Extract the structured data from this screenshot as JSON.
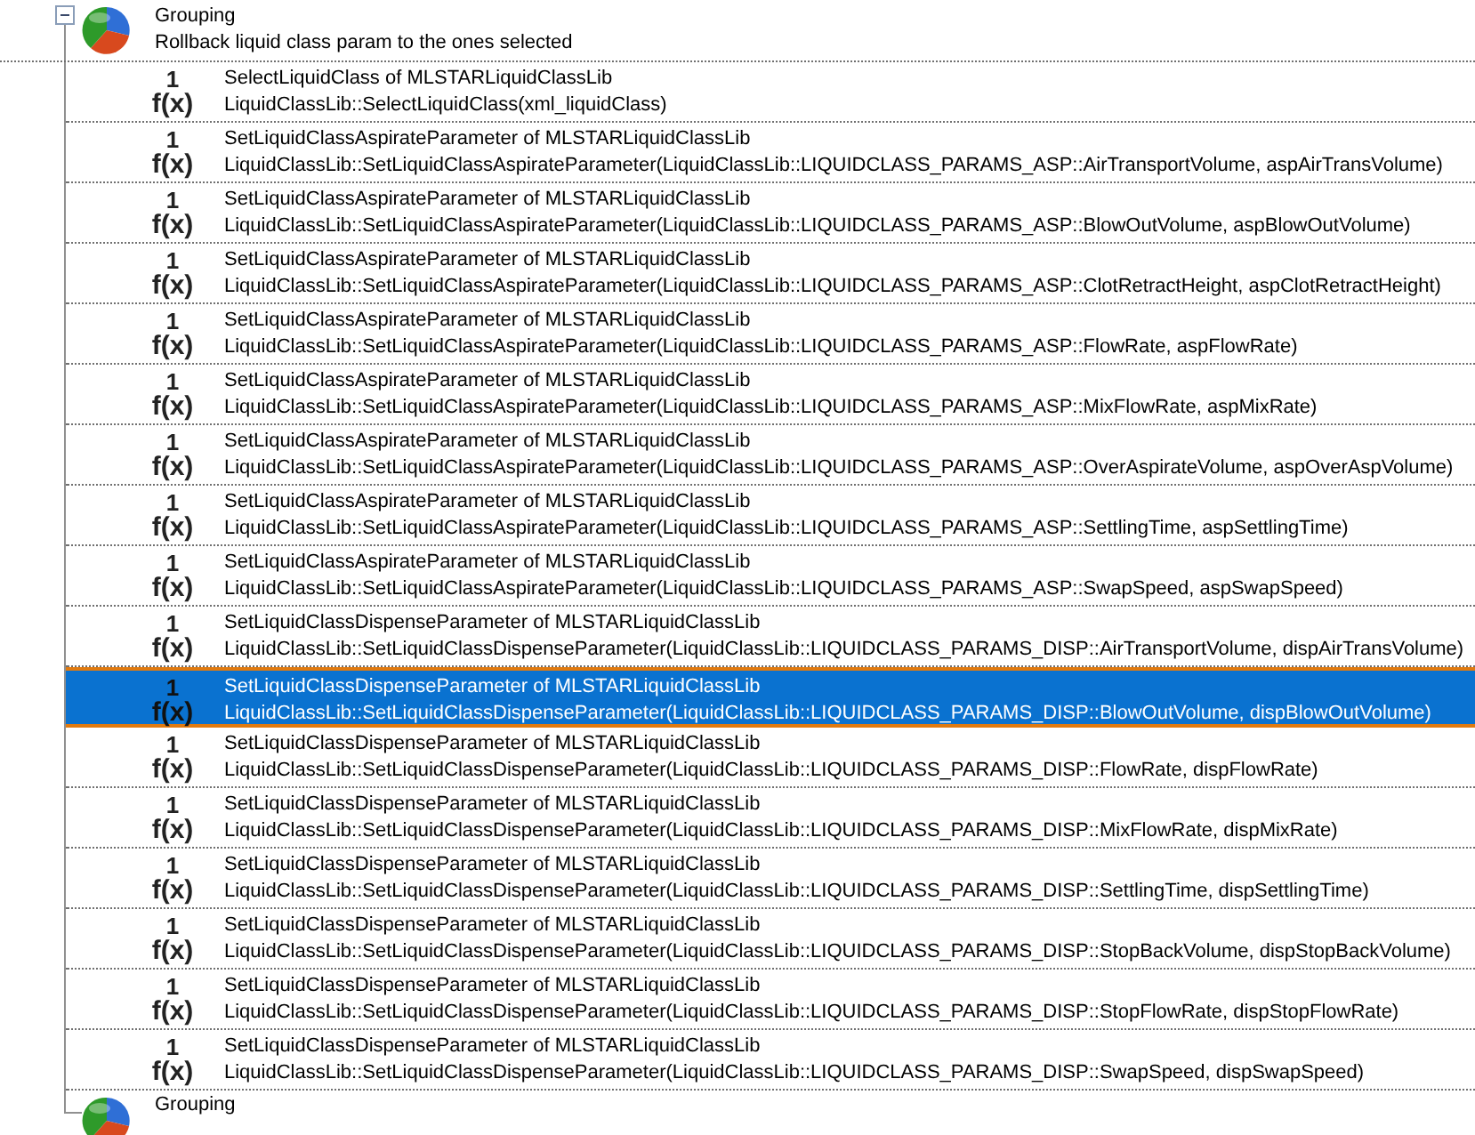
{
  "group": {
    "title": "Grouping",
    "comment": "Rollback liquid class param to the ones selected",
    "expanded": true
  },
  "steps": [
    {
      "number": "1",
      "icon_text": "f(x)",
      "title": "SelectLiquidClass of MLSTARLiquidClassLib",
      "call": "LiquidClassLib::SelectLiquidClass(xml_liquidClass)",
      "selected": false
    },
    {
      "number": "1",
      "icon_text": "f(x)",
      "title": "SetLiquidClassAspirateParameter of MLSTARLiquidClassLib",
      "call": "LiquidClassLib::SetLiquidClassAspirateParameter(LiquidClassLib::LIQUIDCLASS_PARAMS_ASP::AirTransportVolume, aspAirTransVolume)",
      "selected": false
    },
    {
      "number": "1",
      "icon_text": "f(x)",
      "title": "SetLiquidClassAspirateParameter of MLSTARLiquidClassLib",
      "call": "LiquidClassLib::SetLiquidClassAspirateParameter(LiquidClassLib::LIQUIDCLASS_PARAMS_ASP::BlowOutVolume, aspBlowOutVolume)",
      "selected": false
    },
    {
      "number": "1",
      "icon_text": "f(x)",
      "title": "SetLiquidClassAspirateParameter of MLSTARLiquidClassLib",
      "call": "LiquidClassLib::SetLiquidClassAspirateParameter(LiquidClassLib::LIQUIDCLASS_PARAMS_ASP::ClotRetractHeight, aspClotRetractHeight)",
      "selected": false
    },
    {
      "number": "1",
      "icon_text": "f(x)",
      "title": "SetLiquidClassAspirateParameter of MLSTARLiquidClassLib",
      "call": "LiquidClassLib::SetLiquidClassAspirateParameter(LiquidClassLib::LIQUIDCLASS_PARAMS_ASP::FlowRate, aspFlowRate)",
      "selected": false
    },
    {
      "number": "1",
      "icon_text": "f(x)",
      "title": "SetLiquidClassAspirateParameter of MLSTARLiquidClassLib",
      "call": "LiquidClassLib::SetLiquidClassAspirateParameter(LiquidClassLib::LIQUIDCLASS_PARAMS_ASP::MixFlowRate, aspMixRate)",
      "selected": false
    },
    {
      "number": "1",
      "icon_text": "f(x)",
      "title": "SetLiquidClassAspirateParameter of MLSTARLiquidClassLib",
      "call": "LiquidClassLib::SetLiquidClassAspirateParameter(LiquidClassLib::LIQUIDCLASS_PARAMS_ASP::OverAspirateVolume, aspOverAspVolume)",
      "selected": false
    },
    {
      "number": "1",
      "icon_text": "f(x)",
      "title": "SetLiquidClassAspirateParameter of MLSTARLiquidClassLib",
      "call": "LiquidClassLib::SetLiquidClassAspirateParameter(LiquidClassLib::LIQUIDCLASS_PARAMS_ASP::SettlingTime, aspSettlingTime)",
      "selected": false
    },
    {
      "number": "1",
      "icon_text": "f(x)",
      "title": "SetLiquidClassAspirateParameter of MLSTARLiquidClassLib",
      "call": "LiquidClassLib::SetLiquidClassAspirateParameter(LiquidClassLib::LIQUIDCLASS_PARAMS_ASP::SwapSpeed, aspSwapSpeed)",
      "selected": false
    },
    {
      "number": "1",
      "icon_text": "f(x)",
      "title": "SetLiquidClassDispenseParameter of MLSTARLiquidClassLib",
      "call": "LiquidClassLib::SetLiquidClassDispenseParameter(LiquidClassLib::LIQUIDCLASS_PARAMS_DISP::AirTransportVolume, dispAirTransVolume)",
      "selected": false
    },
    {
      "number": "1",
      "icon_text": "f(x)",
      "title": "SetLiquidClassDispenseParameter of MLSTARLiquidClassLib",
      "call": "LiquidClassLib::SetLiquidClassDispenseParameter(LiquidClassLib::LIQUIDCLASS_PARAMS_DISP::BlowOutVolume, dispBlowOutVolume)",
      "selected": true
    },
    {
      "number": "1",
      "icon_text": "f(x)",
      "title": "SetLiquidClassDispenseParameter of MLSTARLiquidClassLib",
      "call": "LiquidClassLib::SetLiquidClassDispenseParameter(LiquidClassLib::LIQUIDCLASS_PARAMS_DISP::FlowRate, dispFlowRate)",
      "selected": false
    },
    {
      "number": "1",
      "icon_text": "f(x)",
      "title": "SetLiquidClassDispenseParameter of MLSTARLiquidClassLib",
      "call": "LiquidClassLib::SetLiquidClassDispenseParameter(LiquidClassLib::LIQUIDCLASS_PARAMS_DISP::MixFlowRate, dispMixRate)",
      "selected": false
    },
    {
      "number": "1",
      "icon_text": "f(x)",
      "title": "SetLiquidClassDispenseParameter of MLSTARLiquidClassLib",
      "call": "LiquidClassLib::SetLiquidClassDispenseParameter(LiquidClassLib::LIQUIDCLASS_PARAMS_DISP::SettlingTime, dispSettlingTime)",
      "selected": false
    },
    {
      "number": "1",
      "icon_text": "f(x)",
      "title": "SetLiquidClassDispenseParameter of MLSTARLiquidClassLib",
      "call": "LiquidClassLib::SetLiquidClassDispenseParameter(LiquidClassLib::LIQUIDCLASS_PARAMS_DISP::StopBackVolume, dispStopBackVolume)",
      "selected": false
    },
    {
      "number": "1",
      "icon_text": "f(x)",
      "title": "SetLiquidClassDispenseParameter of MLSTARLiquidClassLib",
      "call": "LiquidClassLib::SetLiquidClassDispenseParameter(LiquidClassLib::LIQUIDCLASS_PARAMS_DISP::StopFlowRate, dispStopFlowRate)",
      "selected": false
    },
    {
      "number": "1",
      "icon_text": "f(x)",
      "title": "SetLiquidClassDispenseParameter of MLSTARLiquidClassLib",
      "call": "LiquidClassLib::SetLiquidClassDispenseParameter(LiquidClassLib::LIQUIDCLASS_PARAMS_DISP::SwapSpeed, dispSwapSpeed)",
      "selected": false
    }
  ],
  "end_group": {
    "title": "Grouping"
  }
}
